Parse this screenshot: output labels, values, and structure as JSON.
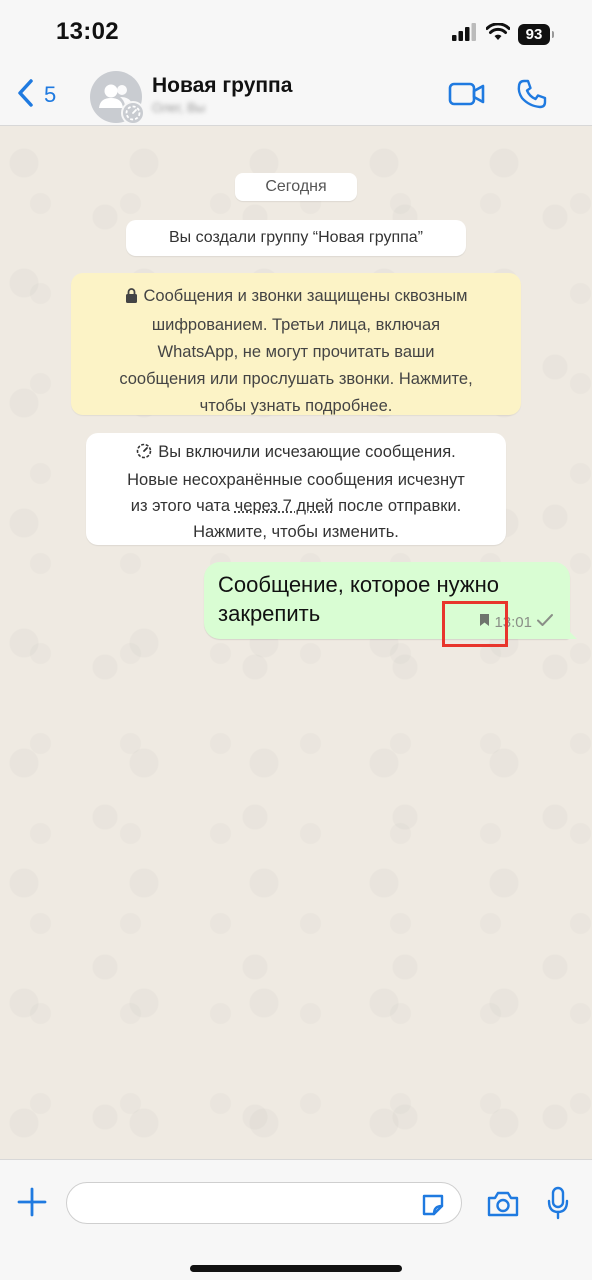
{
  "status_bar": {
    "time": "13:02",
    "battery": "93"
  },
  "header": {
    "back_count": "5",
    "title": "Новая группа",
    "subtitle": "Олег, Вы"
  },
  "chat": {
    "date_label": "Сегодня",
    "system_message": "Вы создали группу “Новая группа”",
    "encryption_notice": {
      "line1": "Сообщения и звонки защищены сквозным",
      "line2": "шифрованием. Третьи лица, включая",
      "line3": "WhatsApp, не могут прочитать ваши",
      "line4": "сообщения или прослушать звонки. Нажмите,",
      "line5": "чтобы узнать подробнее."
    },
    "disappearing_notice": {
      "line1": "Вы включили исчезающие сообщения.",
      "line2": "Новые несохранённые сообщения исчезнут",
      "line3_before": "из этого чата ",
      "line3_link": "через 7 дней",
      "line3_after": " после отправки.",
      "line4": "Нажмите, чтобы изменить."
    },
    "message": {
      "text": "Сообщение, которое нужно закрепить",
      "time": "13:01"
    }
  },
  "input_bar": {
    "placeholder": ""
  },
  "colors": {
    "accent": "#1f7ae0",
    "outgoing_bubble": "#d9fdd3",
    "encryption_bg": "#fcf3c6",
    "highlight": "#e8352c"
  }
}
